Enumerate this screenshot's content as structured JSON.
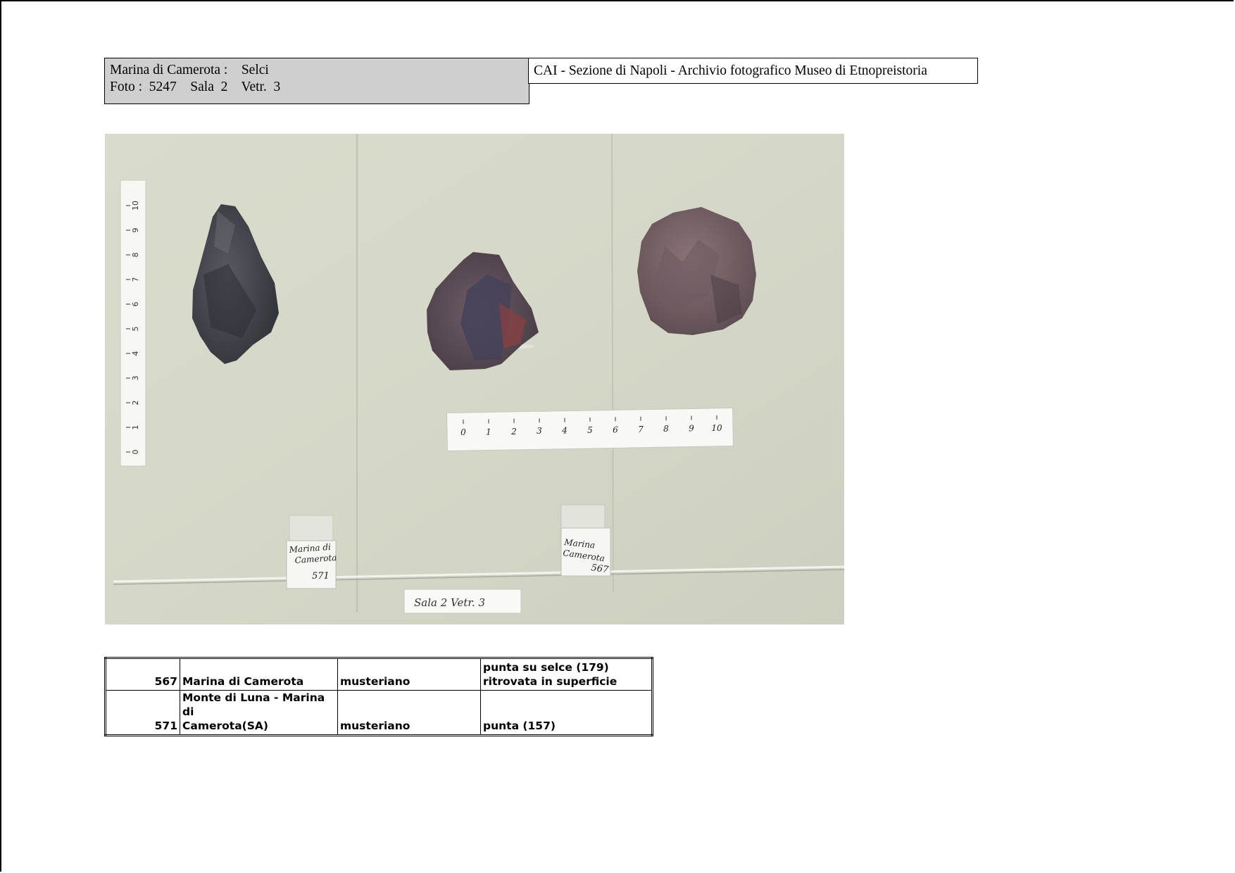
{
  "header": {
    "left_line1": "Marina di Camerota :    Selci",
    "left_line2": "Foto :  5247    Sala  2    Vetr.  3",
    "right": "CAI - Sezione di Napoli  - Archivio fotografico Museo di Etnopreistoria"
  },
  "photo": {
    "vertical_ruler_ticks": [
      "0",
      "1",
      "2",
      "3",
      "4",
      "5",
      "6",
      "7",
      "8",
      "9",
      "10"
    ],
    "horizontal_ruler_ticks": [
      "0",
      "1",
      "2",
      "3",
      "4",
      "5",
      "6",
      "7",
      "8",
      "9",
      "10"
    ],
    "label_571_line1": "Marina di",
    "label_571_line2": "Camerota",
    "label_571_number": "571",
    "label_567_line1": "Marina",
    "label_567_line2": "Camerota",
    "label_567_number": "567",
    "showcase_label": "Sala 2  Vetr. 3"
  },
  "table": {
    "rows": [
      {
        "number": "567",
        "location": "Marina di Camerota",
        "period": "musteriano",
        "description_line1": "punta su selce (179)",
        "description_line2": "ritrovata in superficie"
      },
      {
        "number": "571",
        "location_line1": "Monte di Luna - Marina di",
        "location_line2": "Camerota(SA)",
        "period": "musteriano",
        "description": "punta (157)"
      }
    ]
  }
}
